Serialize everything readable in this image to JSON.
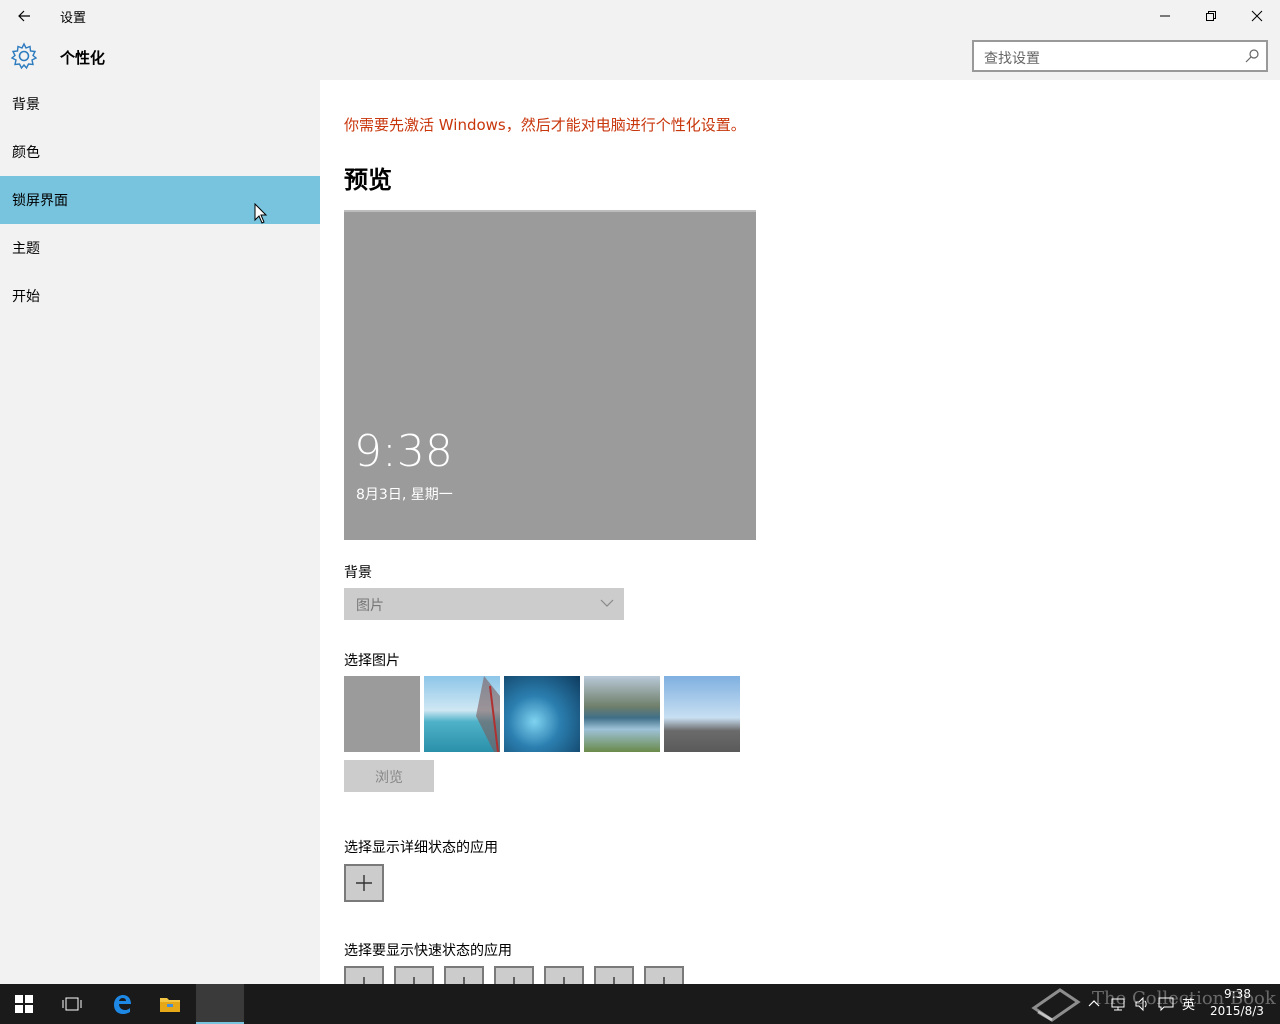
{
  "window": {
    "title": "设置",
    "back_icon": "arrow-left-icon",
    "minimize_icon": "minimize-icon",
    "maximize_icon": "restore-icon",
    "close_icon": "close-icon"
  },
  "header": {
    "title": "个性化",
    "icon": "gear-icon",
    "search_placeholder": "查找设置"
  },
  "sidebar": {
    "items": [
      {
        "label": "背景",
        "active": false
      },
      {
        "label": "颜色",
        "active": false
      },
      {
        "label": "锁屏界面",
        "active": true
      },
      {
        "label": "主题",
        "active": false
      },
      {
        "label": "开始",
        "active": false
      }
    ]
  },
  "content": {
    "activation_warning": "你需要先激活 Windows，然后才能对电脑进行个性化设置。",
    "preview_heading": "预览",
    "preview_time": "9:38",
    "preview_date": "8月3日, 星期一",
    "background_label": "背景",
    "background_value": "图片",
    "choose_picture_label": "选择图片",
    "browse_label": "浏览",
    "detailed_status_label": "选择显示详细状态的应用",
    "quick_status_label": "选择要显示快速状态的应用"
  },
  "taskbar": {
    "time": "9:38",
    "date": "2015/8/3",
    "ime": "英",
    "watermark": "The Collection Book"
  },
  "colors": {
    "accent": "#78c4de",
    "warning": "#c8360c",
    "sidebar_bg": "#f2f2f2",
    "taskbar_bg": "#1a1a1a"
  }
}
